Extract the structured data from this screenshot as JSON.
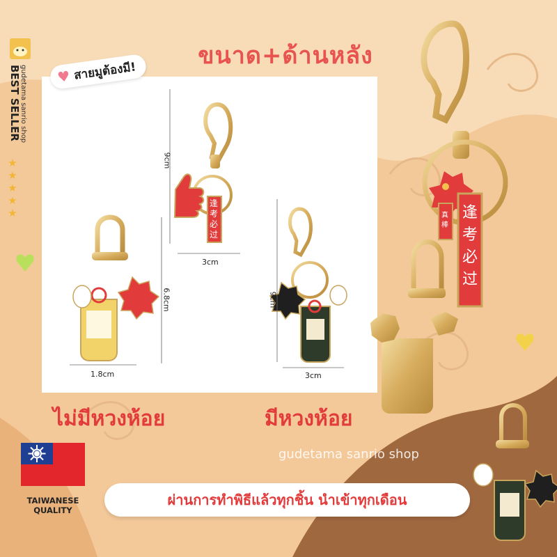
{
  "header": {
    "title": "ขนาด+ด้านหลัง"
  },
  "badge": {
    "label": "สายมูต้องมี!",
    "icon": "heart-icon"
  },
  "sidebar": {
    "shop_name": "gudetama sanrio shop",
    "best_seller": "BEST SELLER",
    "stars": "★★★★★"
  },
  "dimensions": {
    "middle_height": "9cm",
    "middle_width": "3cm",
    "left_height": "6.8cm",
    "left_width": "1.8cm",
    "right_height": "9cm",
    "right_width": "3cm"
  },
  "labels": {
    "without_ring": "ไม่มีหวงห้อย",
    "with_ring": "มีหวงห้อย"
  },
  "watermark": "gudetama sanrio shop",
  "footer": {
    "banner": "ผ่านการทำพิธีแล้วทุกชิ้น นำเข้าทุกเดือน",
    "quality_line1": "TAIWANESE",
    "quality_line2": "QUALITY"
  },
  "charm_text": {
    "tag_vertical": "逢考必过",
    "small_tag": "真棒"
  },
  "colors": {
    "accent_red": "#e23b3b",
    "title_red": "#e8524f",
    "background_peach": "#f4c99a",
    "background_brown": "#a0683f",
    "gold": "#d9b36a",
    "heart_pink": "#f27a8e"
  }
}
